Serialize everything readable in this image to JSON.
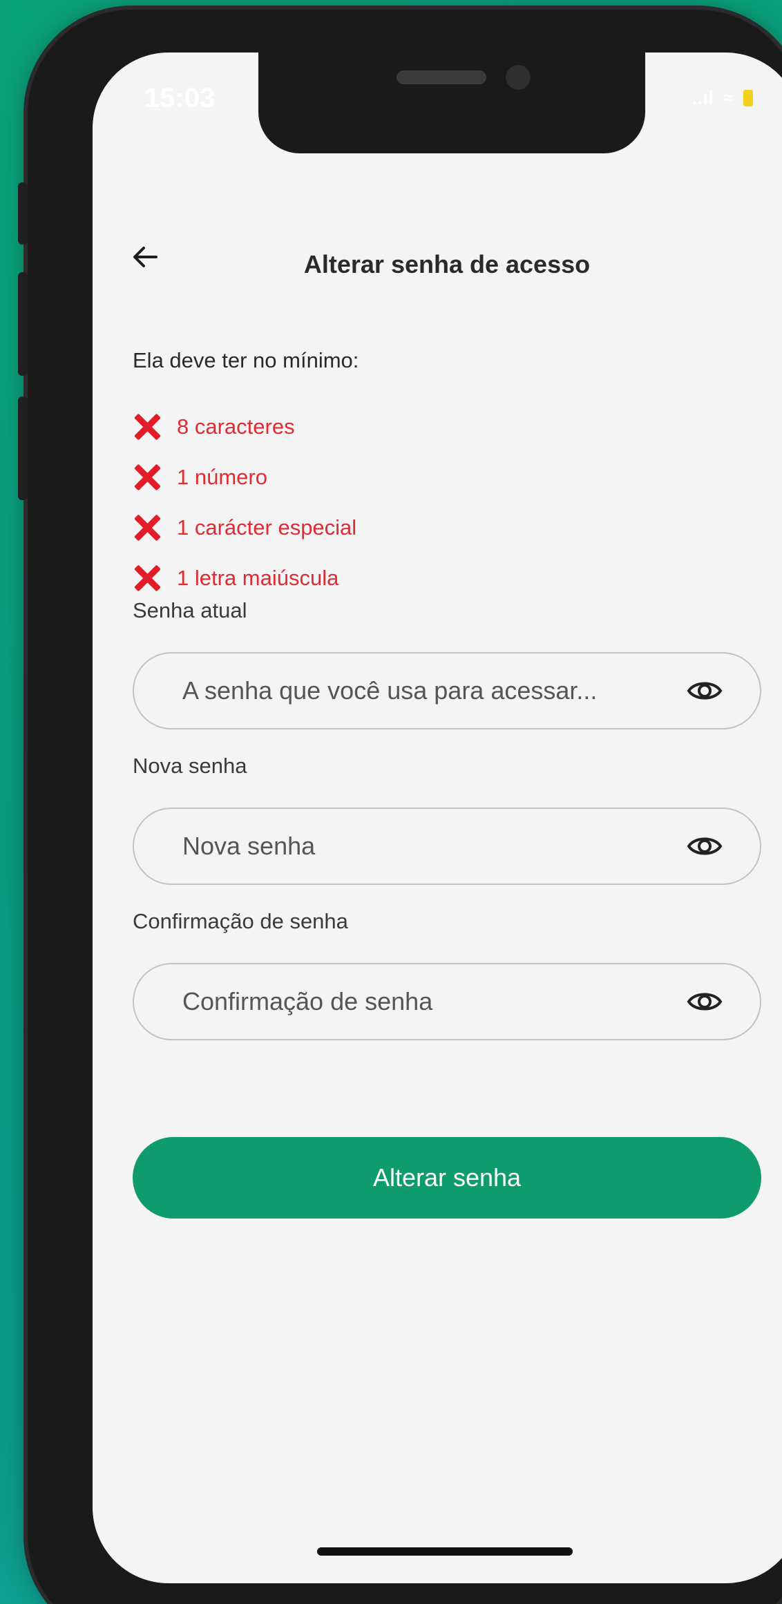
{
  "status_bar": {
    "time": "15:03",
    "signal": "..ıl",
    "wifi": "≈"
  },
  "header": {
    "title": "Alterar senha de acesso"
  },
  "rules": {
    "intro": "Ela deve ter no mínimo:",
    "items": [
      "8 caracteres",
      "1 número",
      "1 carácter especial",
      "1 letra maiúscula"
    ],
    "status_color": "#e02b33"
  },
  "fields": {
    "current": {
      "label": "Senha atual",
      "placeholder": "A senha que você usa para acessar..."
    },
    "new": {
      "label": "Nova senha",
      "placeholder": "Nova senha"
    },
    "confirm": {
      "label": "Confirmação de senha",
      "placeholder": "Confirmação de senha"
    }
  },
  "actions": {
    "submit_label": "Alterar senha",
    "accent_color": "#0e9c6e"
  }
}
